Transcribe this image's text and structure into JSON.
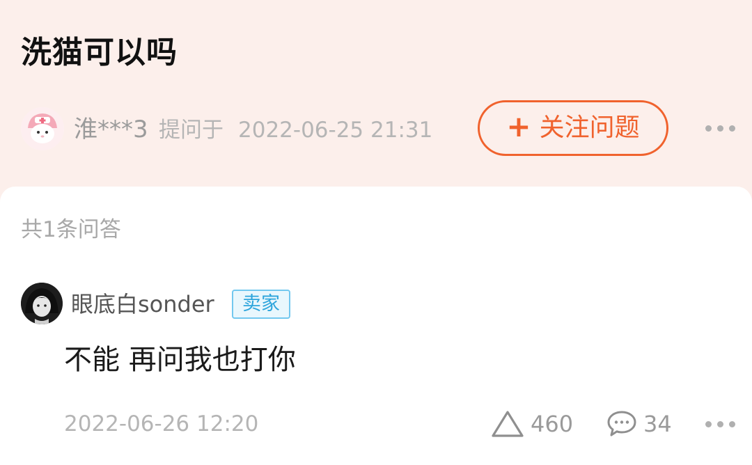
{
  "question": {
    "title": "洗猫可以吗",
    "asker_name": "淮***3",
    "asked_label": "提问于",
    "asked_time": "2022-06-25 21:31",
    "follow_plus": "+",
    "follow_label": "关注问题"
  },
  "answers_section": {
    "count_text": "共1条问答"
  },
  "answer": {
    "author_name": "眼底白sonder",
    "badge": "卖家",
    "text": "不能 再问我也打你",
    "time": "2022-06-26 12:20",
    "likes": "460",
    "comments": "34"
  },
  "colors": {
    "header_bg": "#fcefeb",
    "accent_orange": "#f0622d",
    "badge_blue": "#2da5dc",
    "muted_text": "#b5b5b5"
  },
  "icons": {
    "follow": "plus-icon",
    "more": "more-dots-icon",
    "like": "triangle-up-icon",
    "comment": "speech-bubble-icon"
  }
}
